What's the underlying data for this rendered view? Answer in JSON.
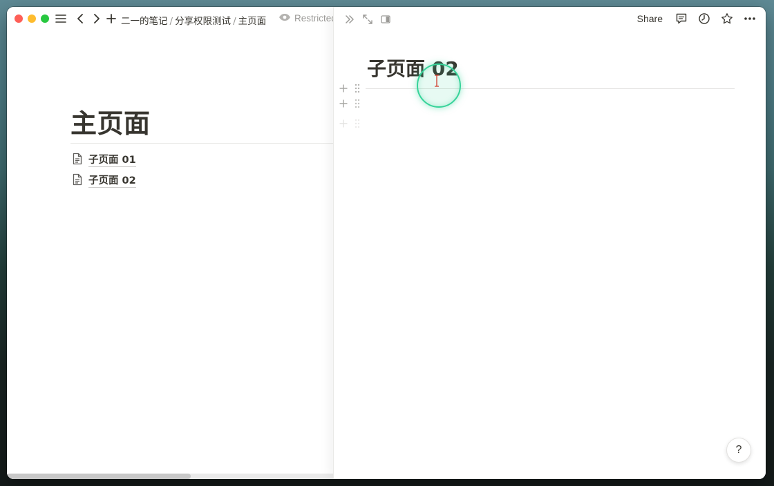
{
  "breadcrumb": {
    "items": [
      "二一的笔记",
      "分享权限测试",
      "主页面"
    ],
    "separator": "/"
  },
  "access": {
    "label": "Restricted",
    "icon": "eye-icon"
  },
  "main_page": {
    "title": "主页面",
    "subpages": [
      {
        "label": "子页面 01",
        "icon": "document-icon"
      },
      {
        "label": "子页面 02",
        "icon": "document-icon"
      }
    ]
  },
  "peek": {
    "title": "子页面 02",
    "share_label": "Share",
    "help_label": "?",
    "action_icons": [
      "comment-icon",
      "clock-icon",
      "star-icon",
      "more-icon"
    ],
    "tool_icons": [
      "double-chevron-right-icon",
      "expand-icon",
      "side-peek-icon"
    ]
  },
  "colors": {
    "cursor_ring": "#36d399",
    "text": "#37352f",
    "muted": "#9b9a97"
  }
}
